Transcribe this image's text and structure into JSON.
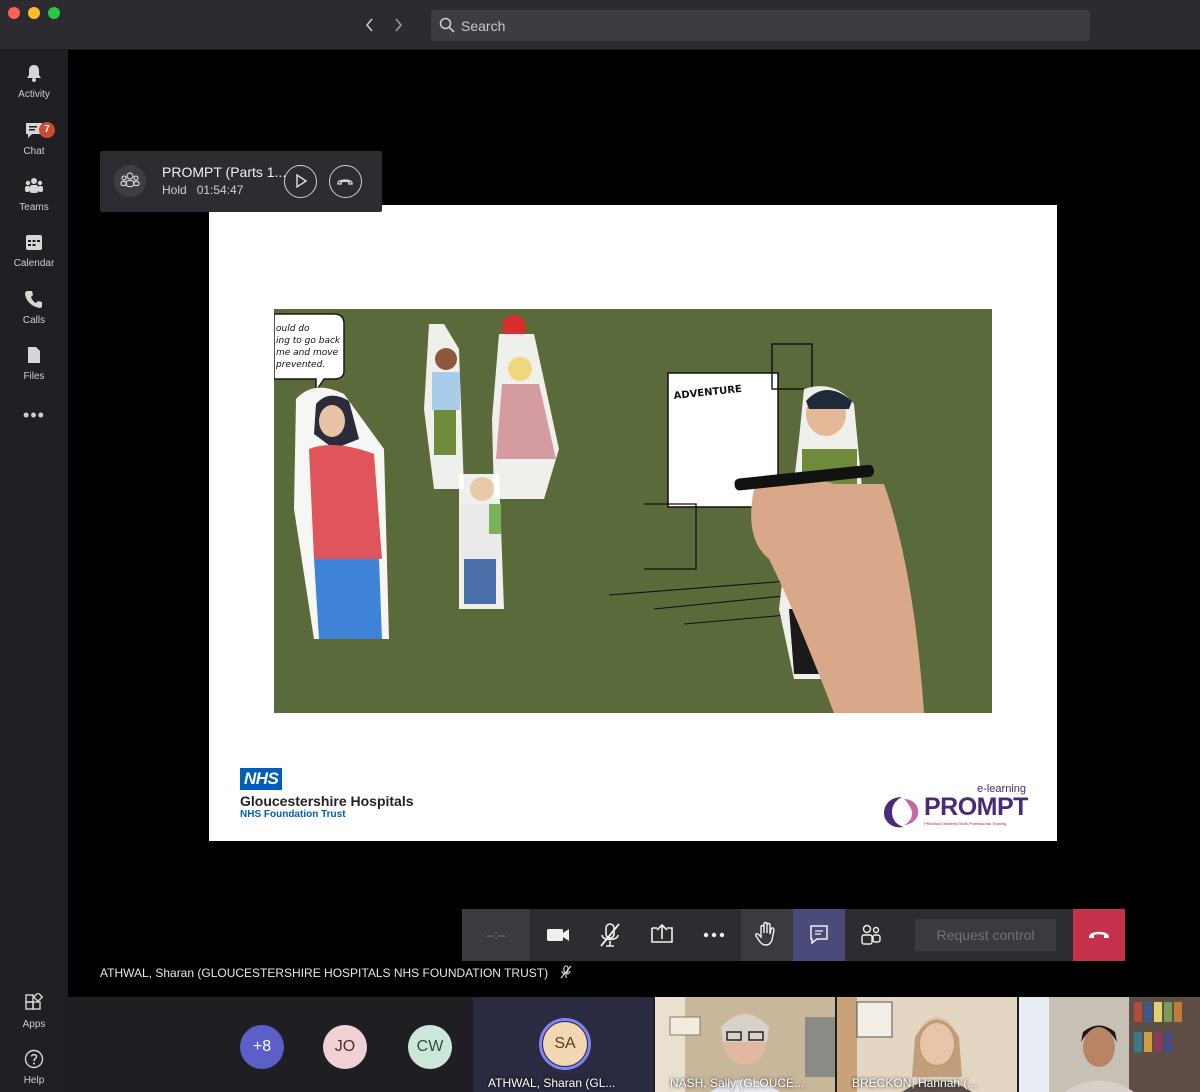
{
  "titlebar": {
    "search_placeholder": "Search"
  },
  "rail": {
    "items": [
      {
        "label": "Activity",
        "icon": "bell-icon"
      },
      {
        "label": "Chat",
        "icon": "chat-icon",
        "badge": "7"
      },
      {
        "label": "Teams",
        "icon": "teams-icon"
      },
      {
        "label": "Calendar",
        "icon": "calendar-icon"
      },
      {
        "label": "Calls",
        "icon": "phone-icon"
      },
      {
        "label": "Files",
        "icon": "file-icon"
      }
    ],
    "more": "•••",
    "bottom": [
      {
        "label": "Apps",
        "icon": "apps-icon"
      },
      {
        "label": "Help",
        "icon": "help-icon"
      }
    ]
  },
  "hold_card": {
    "title": "PROMPT (Parts 1...",
    "status": "Hold",
    "duration": "01:54:47"
  },
  "slide": {
    "video_text": {
      "speech_bubble": [
        "ould do",
        "ing to go back",
        "me and move",
        "prevented."
      ],
      "board_title": "ADVENTURE"
    },
    "nhs": {
      "logo": "NHS",
      "name": "Gloucestershire Hospitals",
      "sub": "NHS Foundation Trust"
    },
    "prompt": {
      "elearning": "e-learning",
      "word": "PROMPT",
      "tagline": "PRactical Obstetric Multi-Professional Training"
    }
  },
  "controls": {
    "timer": "--:--",
    "request_control": "Request control"
  },
  "presenter_label": "ATHWAL, Sharan (GLOUCESTERSHIRE HOSPITALS NHS FOUNDATION TRUST)",
  "participants": {
    "more": "+8",
    "initials": [
      "JO",
      "CW"
    ],
    "tiles": [
      {
        "initials": "SA",
        "name": "ATHWAL, Sharan (GL..."
      },
      {
        "name": "NASH, Sally (GLOUCE..."
      },
      {
        "name": "BRECKON, Hannah (..."
      }
    ]
  },
  "colors": {
    "accent": "#5b5fc7",
    "hangup": "#c4314b",
    "badge": "#cc4a31",
    "nhs_blue": "#005eb8",
    "prompt_purple": "#4a2b78"
  }
}
